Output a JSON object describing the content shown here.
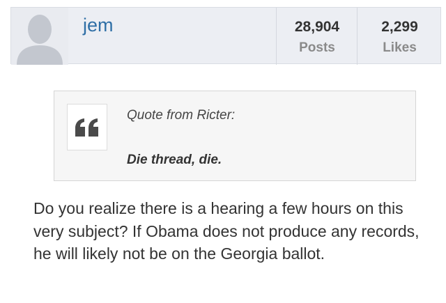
{
  "user": {
    "name": "jem",
    "stats": [
      {
        "value": "28,904",
        "label": "Posts"
      },
      {
        "value": "2,299",
        "label": "Likes"
      }
    ]
  },
  "quote": {
    "attribution": "Quote from Ricter:",
    "text": "Die thread, die."
  },
  "post": {
    "body": "Do you realize there is a hearing a few hours on this very subject? If Obama does not produce any records, he will likely not be on the Georgia ballot."
  },
  "colors": {
    "username": "#2f6fa6",
    "userbar_bg": "#eceef3",
    "quote_bg": "#f6f6f6"
  }
}
